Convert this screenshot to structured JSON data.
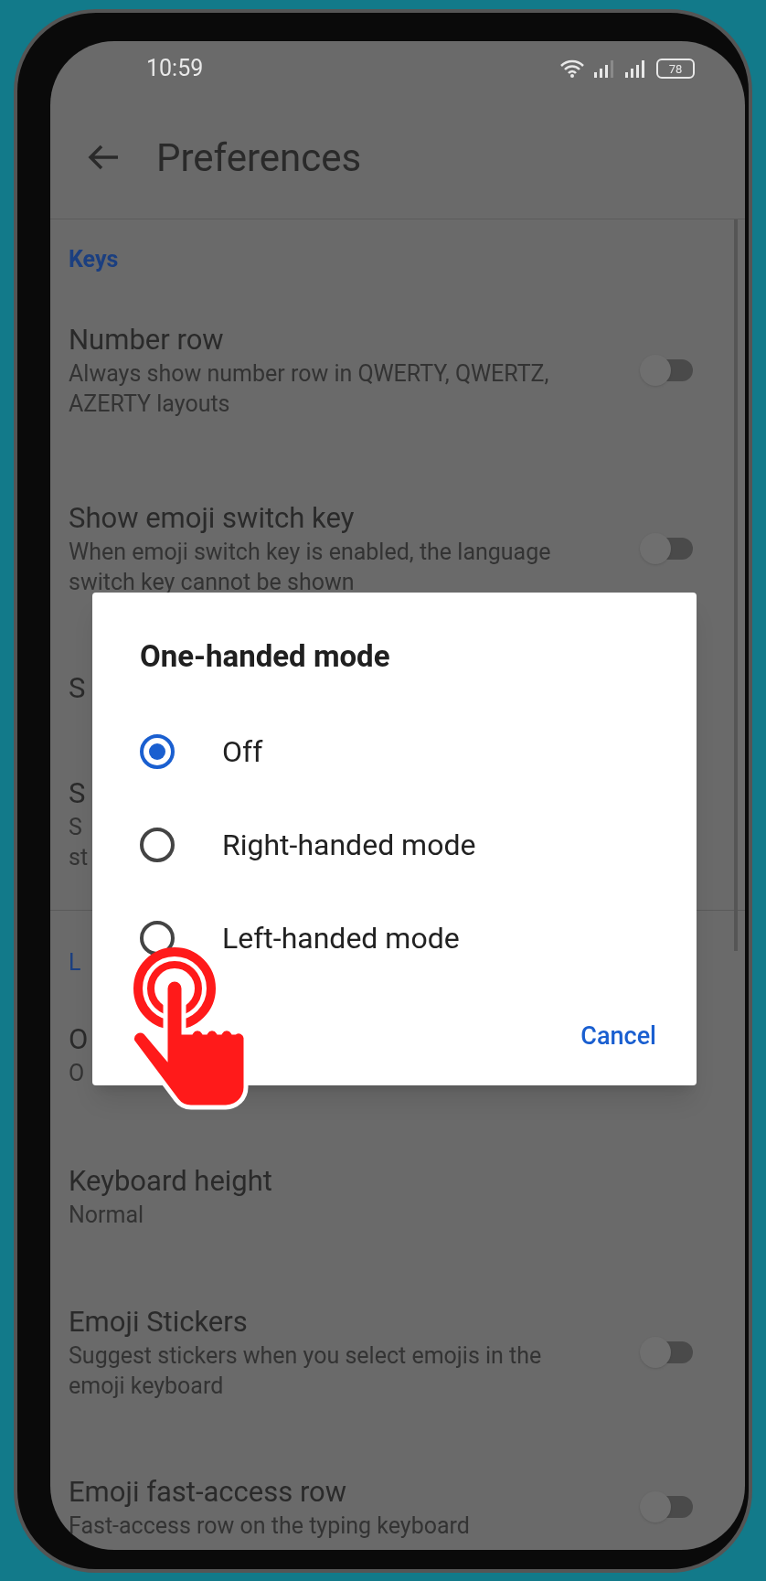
{
  "status_bar": {
    "time": "10:59",
    "battery": "78"
  },
  "app_bar": {
    "title": "Preferences"
  },
  "list": [
    {
      "kind": "header",
      "title": "Keys"
    },
    {
      "kind": "toggle",
      "title": "Number row",
      "subtitle": "Always show number row in QWERTY, QWERTZ, AZERTY layouts",
      "on": false
    },
    {
      "kind": "toggle",
      "title": "Show emoji switch key",
      "subtitle": "When emoji switch key is enabled, the language switch key cannot be shown",
      "on": false
    },
    {
      "kind": "partial",
      "title": "S"
    },
    {
      "kind": "partial",
      "title": "S",
      "subtitle": "S",
      "subtitle_2": "st"
    },
    {
      "kind": "divider"
    },
    {
      "kind": "partial_header",
      "title": "L"
    },
    {
      "kind": "partial",
      "title": "O",
      "subtitle": "O"
    },
    {
      "kind": "plain",
      "title": "Keyboard height",
      "subtitle": "Normal"
    },
    {
      "kind": "toggle",
      "title": "Emoji Stickers",
      "subtitle": "Suggest stickers when you select emojis in the emoji keyboard",
      "on": false
    },
    {
      "kind": "toggle",
      "title": "Emoji fast-access row",
      "subtitle": "Fast-access row on the typing keyboard",
      "on": false
    }
  ],
  "dialog": {
    "title": "One-handed mode",
    "options": [
      {
        "label": "Off",
        "selected": true
      },
      {
        "label": "Right-handed mode",
        "selected": false
      },
      {
        "label": "Left-handed mode",
        "selected": false
      }
    ],
    "button": "Cancel"
  }
}
